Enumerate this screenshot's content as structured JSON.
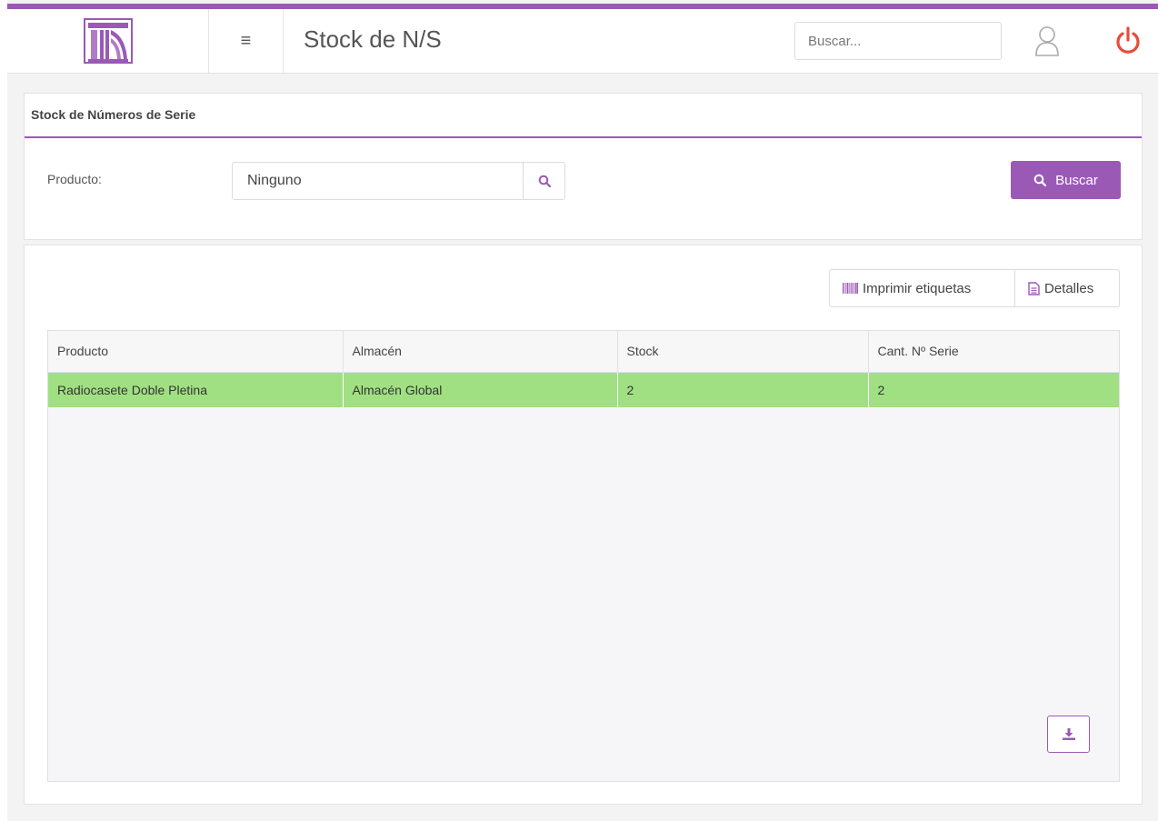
{
  "header": {
    "title": "Stock de N/S",
    "search_placeholder": "Buscar..."
  },
  "filter_card": {
    "title": "Stock de Números de Serie",
    "product_label": "Producto:",
    "product_value": "Ninguno",
    "search_button": "Buscar"
  },
  "toolbar": {
    "print_labels": "Imprimir etiquetas",
    "details": "Detalles"
  },
  "table": {
    "columns": [
      "Producto",
      "Almacén",
      "Stock",
      "Cant. Nº Serie"
    ],
    "rows": [
      [
        "Radiocasete Doble Pletina",
        "Almacén Global",
        "2",
        "2"
      ]
    ]
  },
  "colors": {
    "accent": "#9b59b6",
    "selected_row": "#a0e082",
    "power": "#e74c3c"
  },
  "icons": [
    "logo-icon",
    "menu-icon",
    "user-icon",
    "power-icon",
    "search-icon",
    "barcode-icon",
    "document-icon",
    "download-icon"
  ]
}
